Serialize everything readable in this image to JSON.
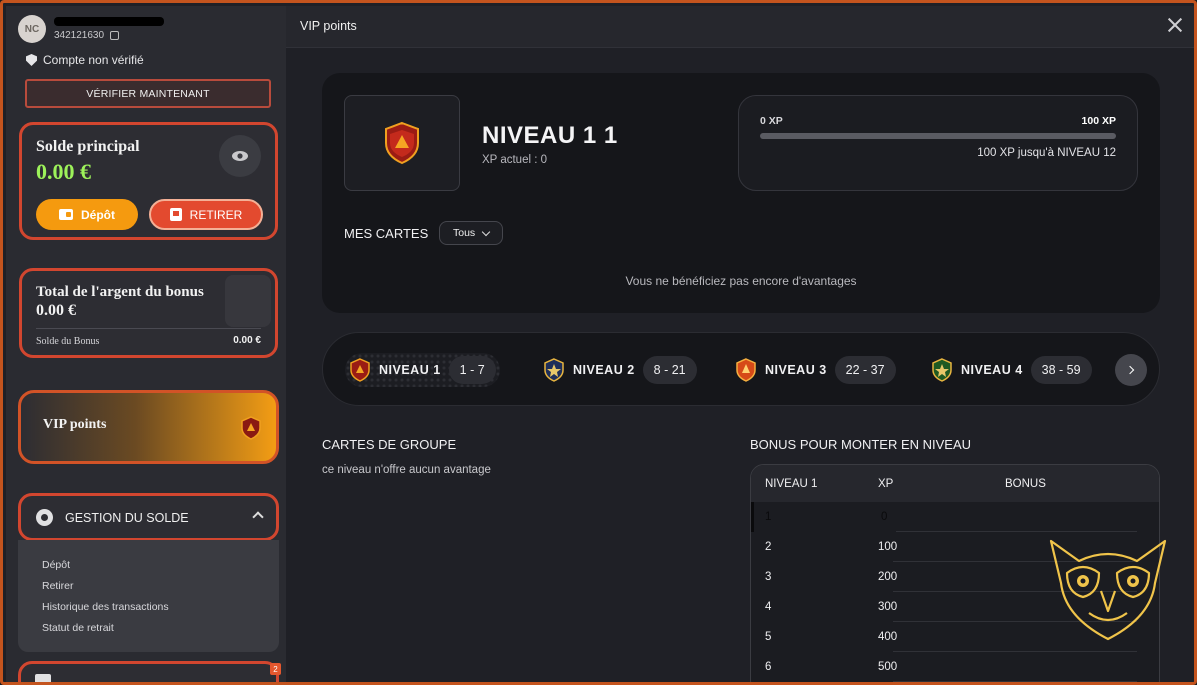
{
  "sidebar": {
    "avatar_initials": "NC",
    "user_id": "342121630",
    "account_status": "Compte non vérifié",
    "verify_button": "VÉRIFIER MAINTENANT",
    "main_balance": {
      "title": "Solde principal",
      "value": "0.00 €",
      "deposit_label": "Dépôt",
      "withdraw_label": "RETIRER"
    },
    "bonus_balance": {
      "title": "Total de l'argent du bonus",
      "value": "0.00 €",
      "sub_label": "Solde du Bonus",
      "sub_value": "0.00 €"
    },
    "vip_label": "VIP points",
    "management": {
      "label": "GESTION DU SOLDE",
      "items": [
        "Dépôt",
        "Retirer",
        "Historique des transactions",
        "Statut de retrait"
      ]
    },
    "notification_count": "2"
  },
  "main": {
    "header_title": "VIP points",
    "level": {
      "title": "NIVEAU 1 1",
      "current_xp": "XP actuel : 0"
    },
    "xp": {
      "min": "0 XP",
      "max": "100 XP",
      "progress": 0.0,
      "next_label": "100 XP jusqu'à NIVEAU 12"
    },
    "cards": {
      "label": "MES CARTES",
      "filter_value": "Tous",
      "empty_text": "Vous ne bénéficiez pas encore d'avantages"
    },
    "levels": [
      {
        "name": "NIVEAU 1",
        "range": "1 - 7"
      },
      {
        "name": "NIVEAU 2",
        "range": "8 - 21"
      },
      {
        "name": "NIVEAU 3",
        "range": "22 - 37"
      },
      {
        "name": "NIVEAU 4",
        "range": "38 - 59"
      }
    ],
    "group_cards": {
      "title": "CARTES DE GROUPE",
      "text": "ce niveau n'offre aucun avantage"
    },
    "level_bonus": {
      "title": "BONUS POUR MONTER EN NIVEAU",
      "headers": [
        "NIVEAU 1",
        "XP",
        "BONUS"
      ],
      "rows": [
        [
          "1",
          "0",
          ""
        ],
        [
          "2",
          "100",
          ""
        ],
        [
          "3",
          "200",
          ""
        ],
        [
          "4",
          "300",
          ""
        ],
        [
          "5",
          "400",
          ""
        ],
        [
          "6",
          "500",
          ""
        ]
      ]
    }
  },
  "colors": {
    "accent_orange": "#f59a0f",
    "accent_red": "#d2462f",
    "balance_green": "#9df25a",
    "frame": "#c4541e"
  }
}
